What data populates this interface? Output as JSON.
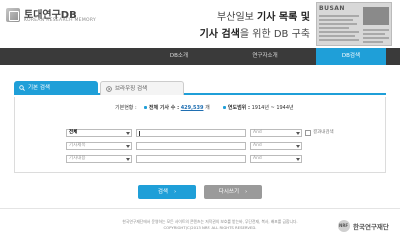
{
  "brand": {
    "title": "토대연구DB",
    "subtitle": "KOREAN RESEARCH MEMORY"
  },
  "headline": {
    "line1_prefix": "부산일보 ",
    "line1_bold": "기사 목록 및",
    "line2_bold": "기사 검색",
    "line2_suffix": "을 위한 DB 구축"
  },
  "newspaper_mast": "BUSAN",
  "nav": {
    "items": [
      {
        "label": "DB소개"
      },
      {
        "label": "연구자소개"
      },
      {
        "label": "DB검색"
      }
    ]
  },
  "tabs": {
    "basic": "기본 검색",
    "browse": "브라우징 검색"
  },
  "stats": {
    "status_label": "기본현황 :",
    "total_label": "전체 기사 수 :",
    "total_count": "429,539",
    "total_unit": "개",
    "period_label": "연도범위 :",
    "period_value": "1914년 ~ 1944년"
  },
  "search_rows": [
    {
      "field": "전체",
      "op": ""
    },
    {
      "field": "기사제목",
      "op": "And"
    },
    {
      "field": "기사내용",
      "op": "And"
    }
  ],
  "first_row_op": "And",
  "result_search_label": "결과내검색",
  "buttons": {
    "search": "검색",
    "reset": "다시쓰기",
    "chev": "›"
  },
  "footer": {
    "line1": "한국연구재단에서 운영하는 모든 사이트의 콘텐츠는 저작권의 보호를 받는바, 무단전재, 복사, 배포를 금합니다.",
    "line2": "COPYRIGHT(C)2013 NRF. ALL RIGHTS RESERVED.",
    "org_mark": "NRF",
    "org_name": "한국연구재단"
  },
  "colors": {
    "accent": "#1f9fd8",
    "nav_bg": "#3a3a3a",
    "reset_btn": "#9a9a9a"
  },
  "icons": {
    "search_tab": "magnifier-icon",
    "browse_tab": "browse-icon",
    "select_arrow": "triangle-down-icon"
  }
}
